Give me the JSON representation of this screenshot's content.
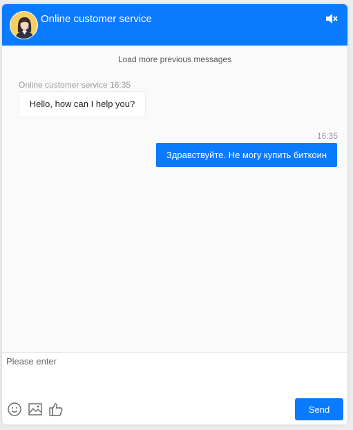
{
  "header": {
    "title": "Online customer service",
    "mute_icon": "speaker-mute-icon",
    "avatar_icon": "agent-avatar"
  },
  "chat": {
    "load_more": "Load more previous messages",
    "messages": [
      {
        "side": "left",
        "meta": "Online customer service 16:35",
        "text": "Hello, how can I help you?"
      },
      {
        "side": "right",
        "meta": "16:35",
        "text": "Здравствуйте. Не могу купить биткоин"
      }
    ]
  },
  "composer": {
    "placeholder": "Please enter",
    "value": "",
    "send_label": "Send",
    "tools": [
      "emoji-icon",
      "image-icon",
      "thumbs-up-icon"
    ]
  },
  "colors": {
    "accent": "#0a7bff",
    "chat_background": "#fafafa"
  }
}
